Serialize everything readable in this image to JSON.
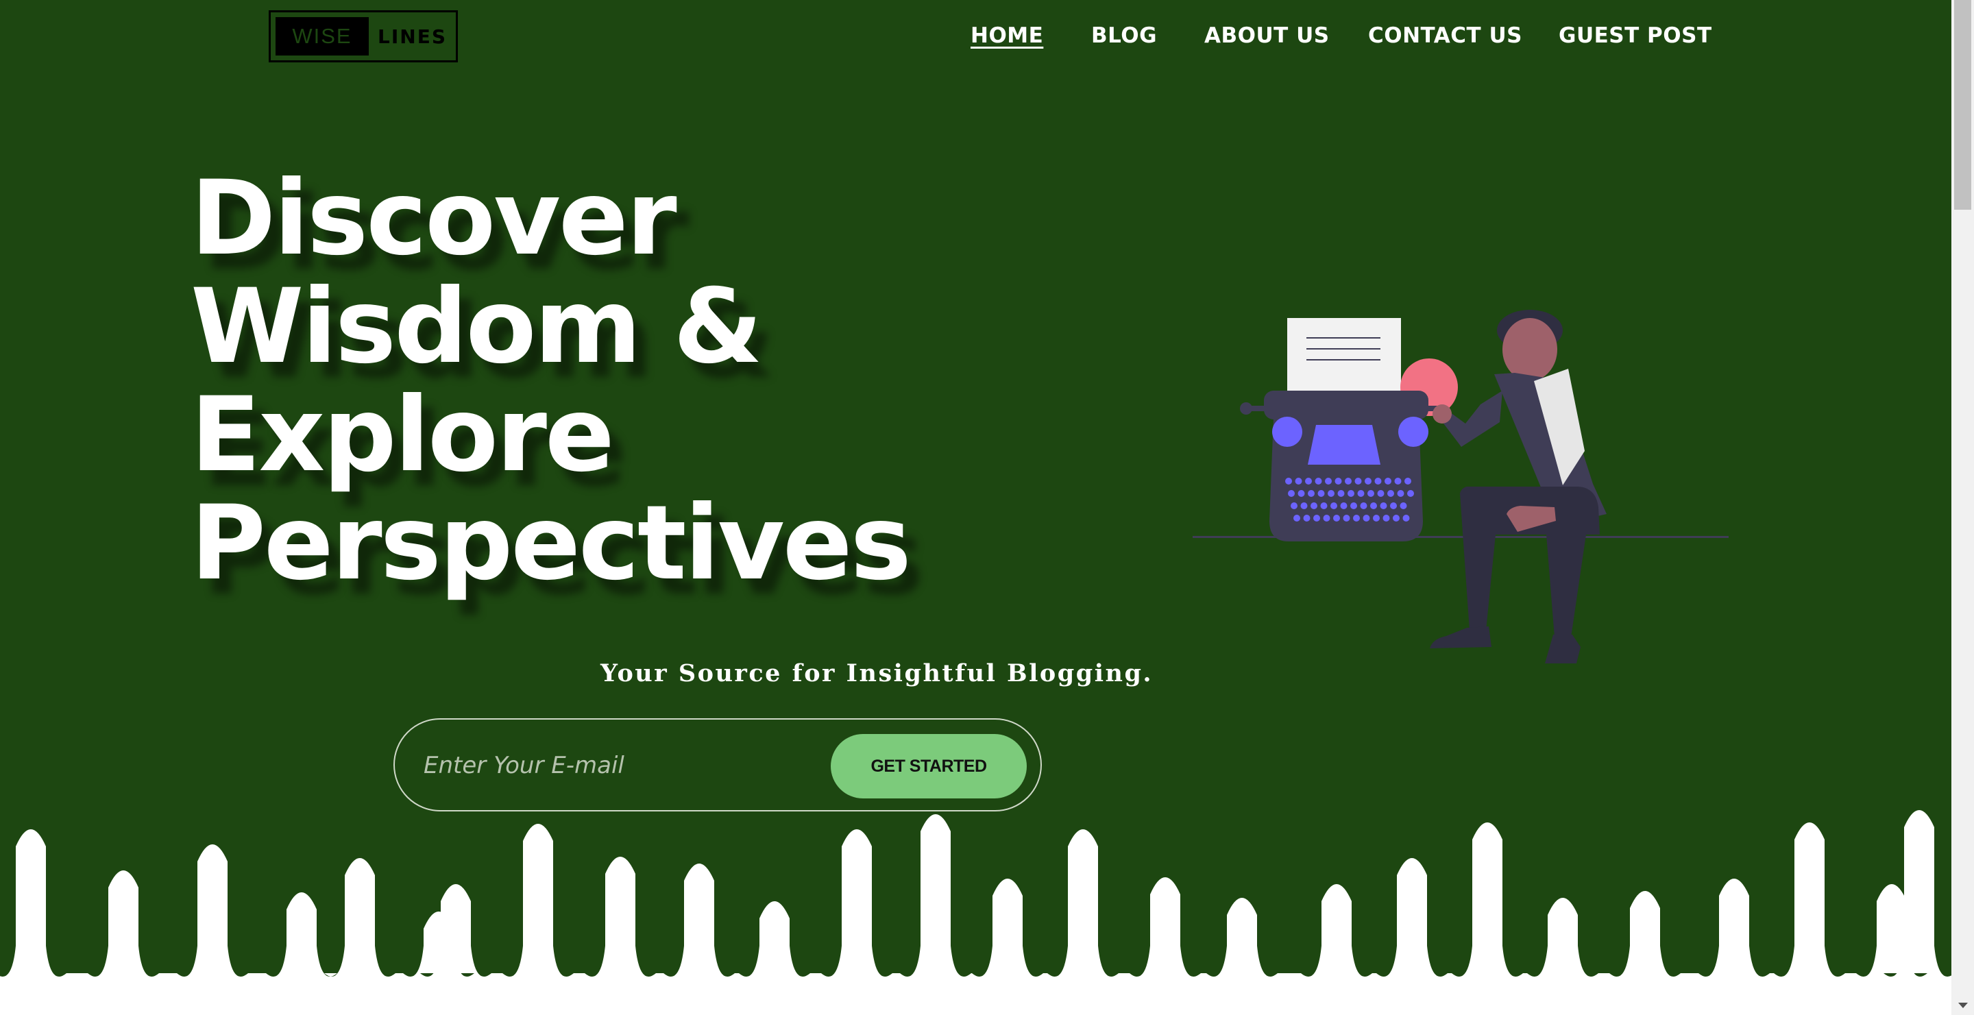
{
  "logo": {
    "part1": "WISE",
    "part2": "LINES"
  },
  "nav": [
    {
      "label": "HOME",
      "active": true
    },
    {
      "label": "BLOG",
      "active": false
    },
    {
      "label": "ABOUT US",
      "active": false
    },
    {
      "label": "CONTACT US",
      "active": false
    },
    {
      "label": "GUEST POST",
      "active": false
    }
  ],
  "hero": {
    "headline_lines": [
      "Discover",
      "Wisdom &",
      "Explore",
      "Perspectives"
    ],
    "tagline": "Your Source for Insightful Blogging.",
    "email_placeholder": "Enter Your E-mail",
    "cta_label": "GET STARTED"
  },
  "colors": {
    "background": "#1d4711",
    "button": "#7ccb7b",
    "drip": "#ffffff",
    "illustration_purple": "#6c63ff",
    "illustration_dark": "#3f3d56",
    "illustration_pink": "#f27284"
  },
  "icons": {
    "scroll_down": "chevron-down-icon"
  }
}
